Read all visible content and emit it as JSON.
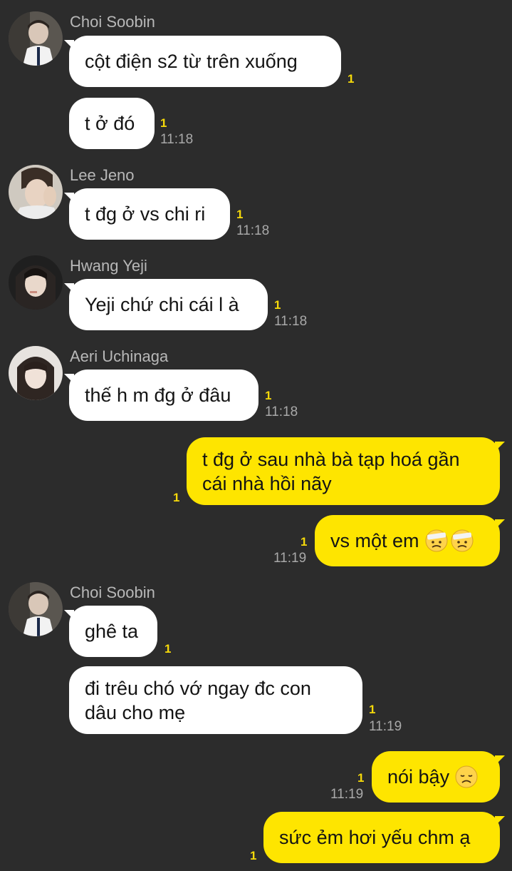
{
  "messages": [
    {
      "sender": "Choi Soobin",
      "text": "cột điện s2 từ trên xuống",
      "unread": "1",
      "time": ""
    },
    {
      "text": "t ở đó",
      "unread": "1",
      "time": "11:18"
    },
    {
      "sender": "Lee Jeno",
      "text": "t đg ở vs chi ri",
      "unread": "1",
      "time": "11:18"
    },
    {
      "sender": "Hwang Yeji",
      "text": "Yeji chứ chi cái l à",
      "unread": "1",
      "time": "11:18"
    },
    {
      "sender": "Aeri Uchinaga",
      "text": "thế h m đg ở đâu",
      "unread": "1",
      "time": "11:18"
    },
    {
      "text": "t đg ở sau nhà bà tạp hoá gần cái nhà hồi nãy",
      "unread": "1",
      "time": ""
    },
    {
      "text": "vs một em",
      "emoji": [
        "bandaged-face-emoji",
        "bandaged-face-emoji"
      ],
      "unread": "1",
      "time": "11:19"
    },
    {
      "sender": "Choi Soobin",
      "text": "ghê ta",
      "unread": "1",
      "time": ""
    },
    {
      "text": "đi trêu chó vớ ngay đc con dâu cho mẹ",
      "unread": "1",
      "time": "11:19"
    },
    {
      "text": "nói bậy",
      "emoji": [
        "disappointed-face-emoji"
      ],
      "unread": "1",
      "time": "11:19"
    },
    {
      "text": "sức ẻm hơi yếu chm ạ",
      "unread": "1",
      "time": ""
    }
  ],
  "colors": {
    "background": "#2c2c2c",
    "incoming_bubble": "#ffffff",
    "outgoing_bubble": "#fee500",
    "unread": "#f5d90a",
    "sender_name": "#b8b8b8",
    "timestamp": "#a9a9a9"
  }
}
